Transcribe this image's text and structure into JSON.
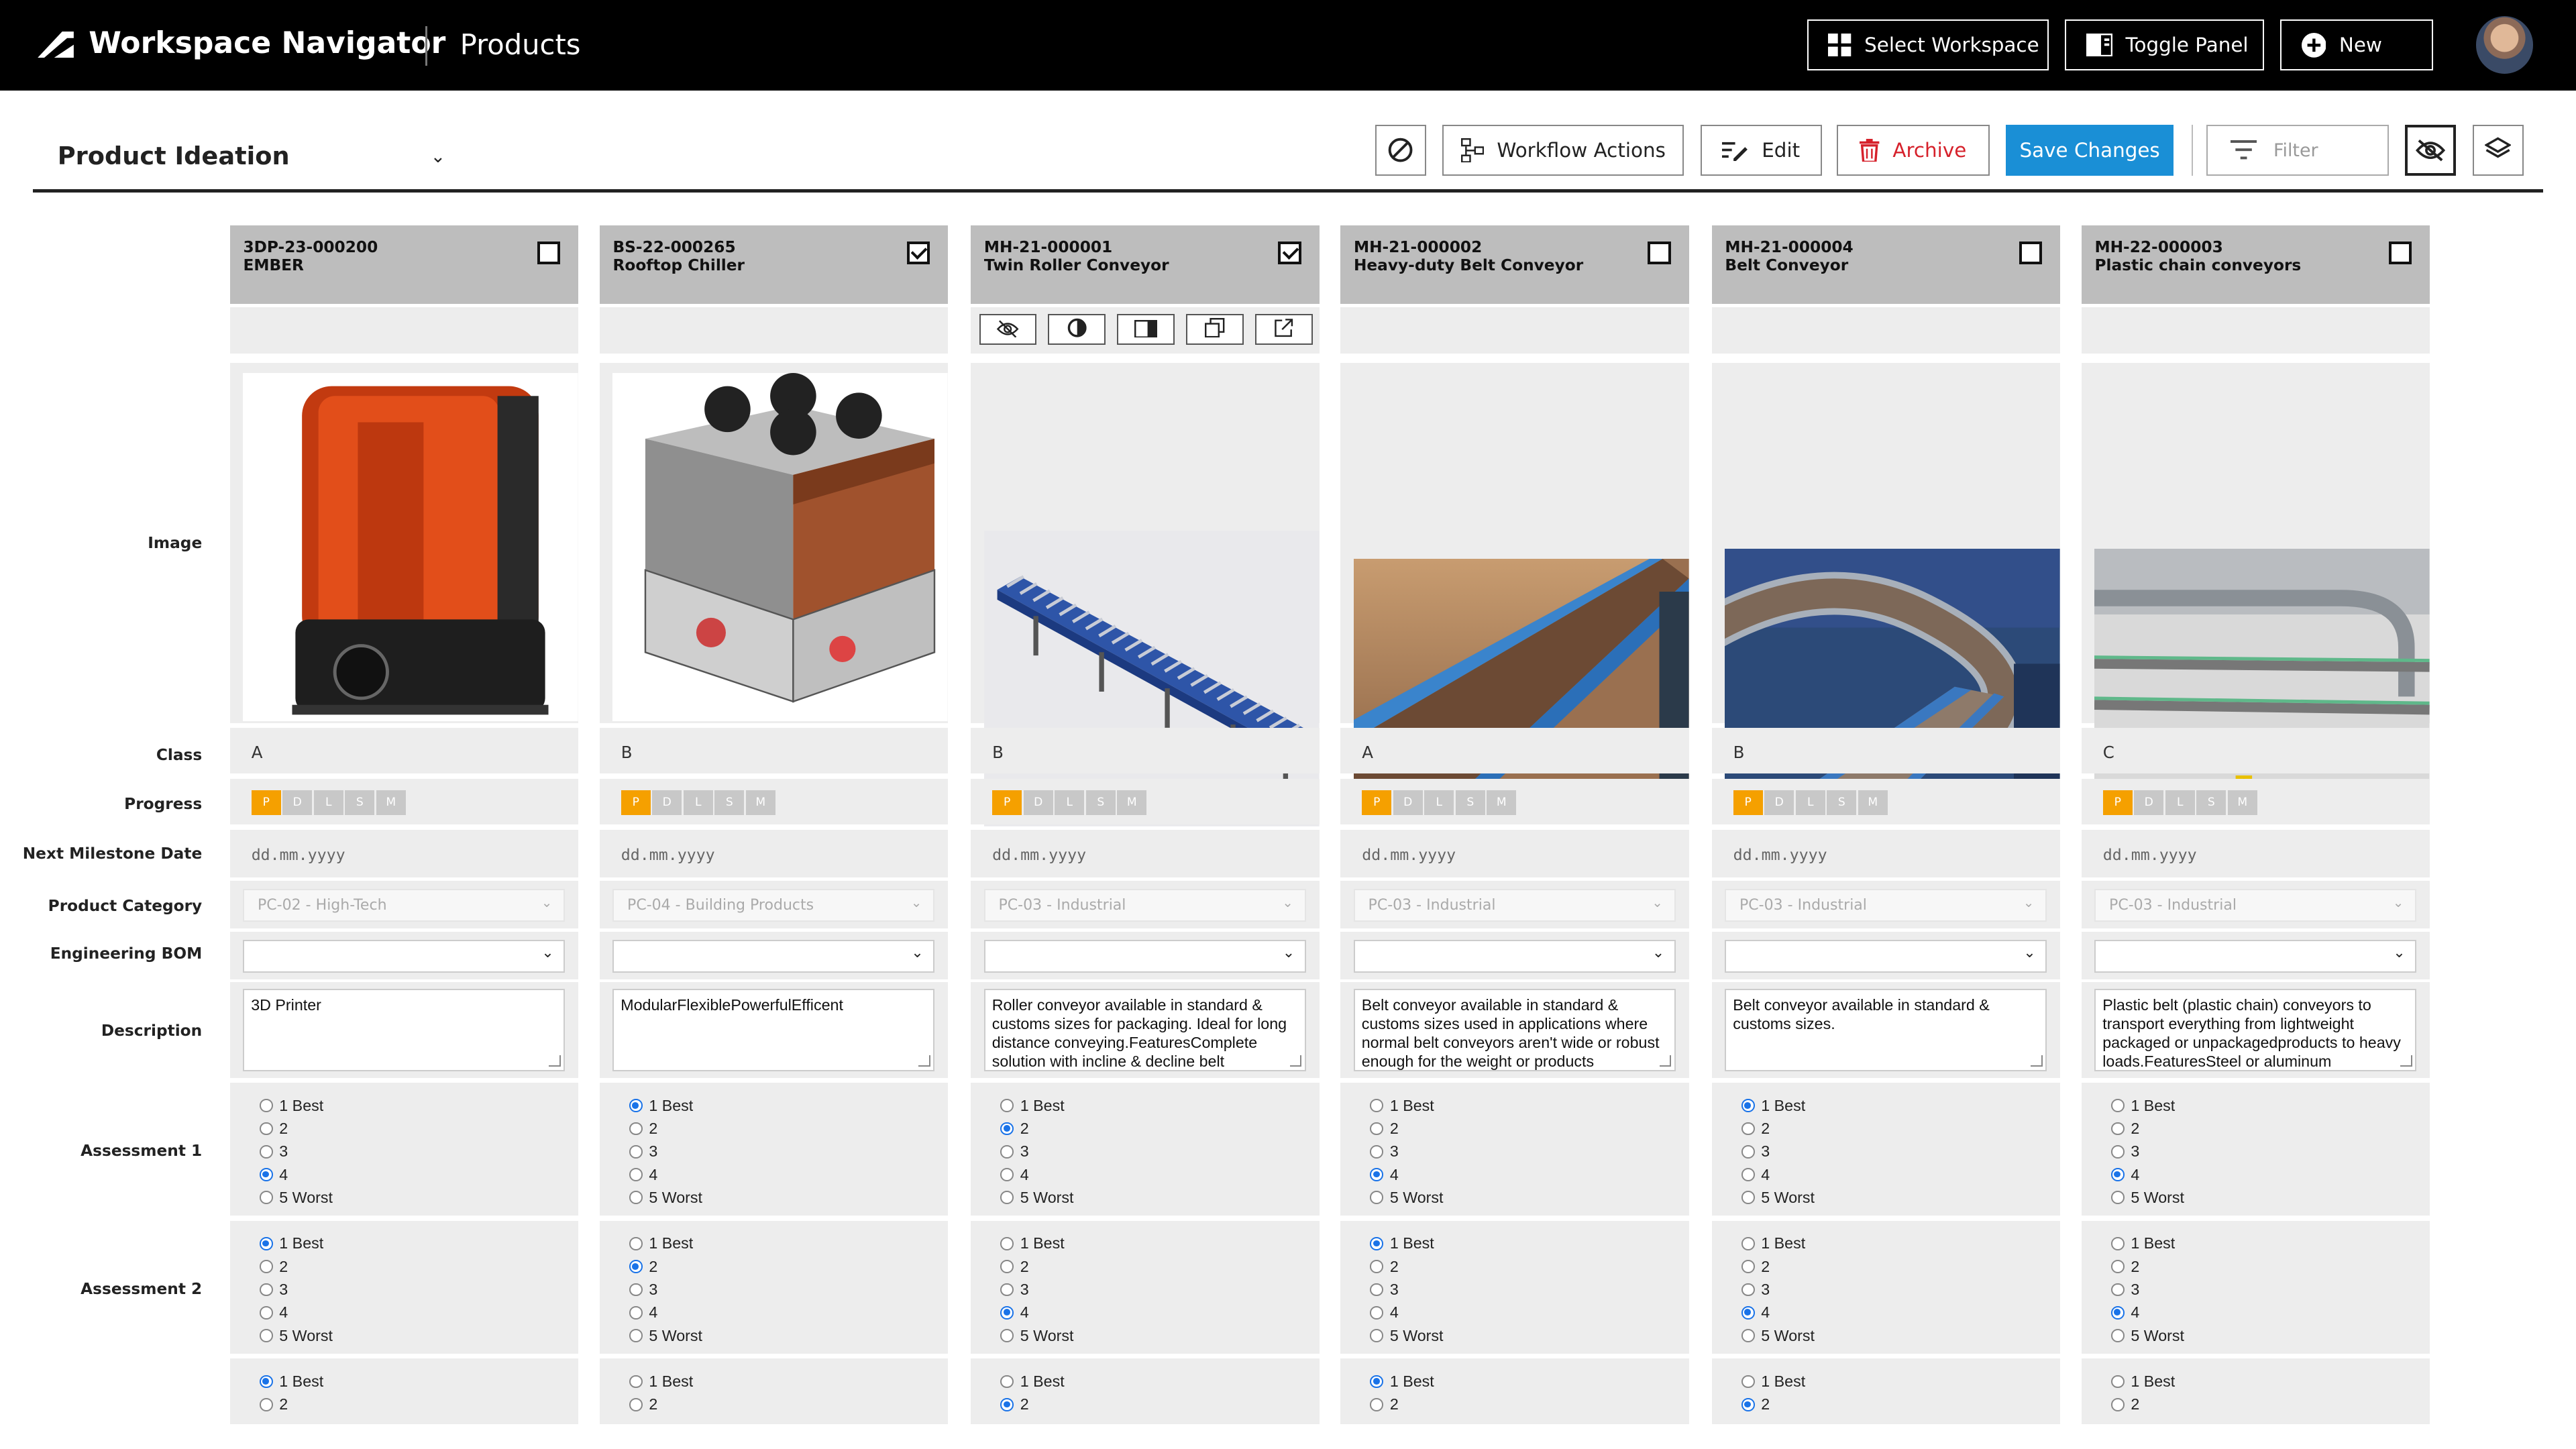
{
  "topbar": {
    "app_title": "Workspace Navigator",
    "section": "Products",
    "buttons": {
      "select_workspace": "Select Workspace",
      "toggle_panel": "Toggle Panel",
      "new": "New"
    }
  },
  "toolbar": {
    "workspace": "Product Ideation",
    "workflow_actions": "Workflow Actions",
    "edit": "Edit",
    "archive": "Archive",
    "save_changes": "Save Changes",
    "filter_placeholder": "Filter"
  },
  "row_labels": {
    "image": "Image",
    "class": "Class",
    "progress": "Progress",
    "next_milestone": "Next Milestone Date",
    "product_category": "Product Category",
    "engineering_bom": "Engineering BOM",
    "description": "Description",
    "assessment1": "Assessment 1",
    "assessment2": "Assessment 2"
  },
  "progress_steps": [
    "P",
    "D",
    "L",
    "S",
    "M"
  ],
  "radio_options": [
    "1 Best",
    "2",
    "3",
    "4",
    "5 Worst"
  ],
  "date_placeholder": "dd.mm.yyyy",
  "items": [
    {
      "id": "3DP-23-000200",
      "name": "EMBER",
      "checked": false,
      "image": "3d-printer",
      "class": "A",
      "progress_step": "P",
      "category": "PC-02 - High-Tech",
      "description": "3D Printer",
      "assessment1": "4",
      "assessment2": "1 Best",
      "assessment3": "1 Best"
    },
    {
      "id": "BS-22-000265",
      "name": "Rooftop Chiller",
      "checked": true,
      "image": "rooftop-chiller",
      "class": "B",
      "progress_step": "P",
      "category": "PC-04 - Building Products",
      "description": "ModularFlexiblePowerfulEfficent",
      "assessment1": "1 Best",
      "assessment2": "2",
      "assessment3": "none"
    },
    {
      "id": "MH-21-000001",
      "name": "Twin Roller Conveyor",
      "checked": true,
      "image": "twin-roller-conveyor",
      "class": "B",
      "progress_step": "P",
      "category": "PC-03 - Industrial",
      "description": "Roller conveyor available in standard & customs sizes for packaging. Ideal for long distance conveying.FeaturesComplete solution with incline & decline belt",
      "assessment1": "2",
      "assessment2": "4",
      "assessment3": "2"
    },
    {
      "id": "MH-21-000002",
      "name": "Heavy-duty Belt Conveyor",
      "checked": false,
      "image": "heavy-duty-belt-conveyor",
      "class": "A",
      "progress_step": "P",
      "category": "PC-03 - Industrial",
      "description": "Belt conveyor available in standard & customs sizes used in applications where normal belt conveyors aren't wide or robust enough for the weight or products",
      "assessment1": "4",
      "assessment2": "1 Best",
      "assessment3": "1 Best"
    },
    {
      "id": "MH-21-000004",
      "name": "Belt Conveyor",
      "checked": false,
      "image": "belt-conveyor",
      "class": "B",
      "progress_step": "P",
      "category": "PC-03 - Industrial",
      "description": "Belt conveyor available in standard & customs sizes.",
      "assessment1": "1 Best",
      "assessment2": "4",
      "assessment3": "2"
    },
    {
      "id": "MH-22-000003",
      "name": "Plastic chain conveyors",
      "checked": false,
      "image": "plastic-chain-conveyor",
      "class": "C",
      "progress_step": "P",
      "category": "PC-03 - Industrial",
      "description": "Plastic belt (plastic chain) conveyors to transport everything from lightweight packaged or unpackagedproducts to heavy loads.FeaturesSteel or aluminum",
      "assessment1": "4",
      "assessment2": "4",
      "assessment3": "none"
    }
  ],
  "colors": {
    "accent": "#1a8fd6",
    "archive": "#d6212b",
    "progress_active": "#f5a000",
    "header_bg": "#000000",
    "column_header": "#bdbdbd"
  }
}
